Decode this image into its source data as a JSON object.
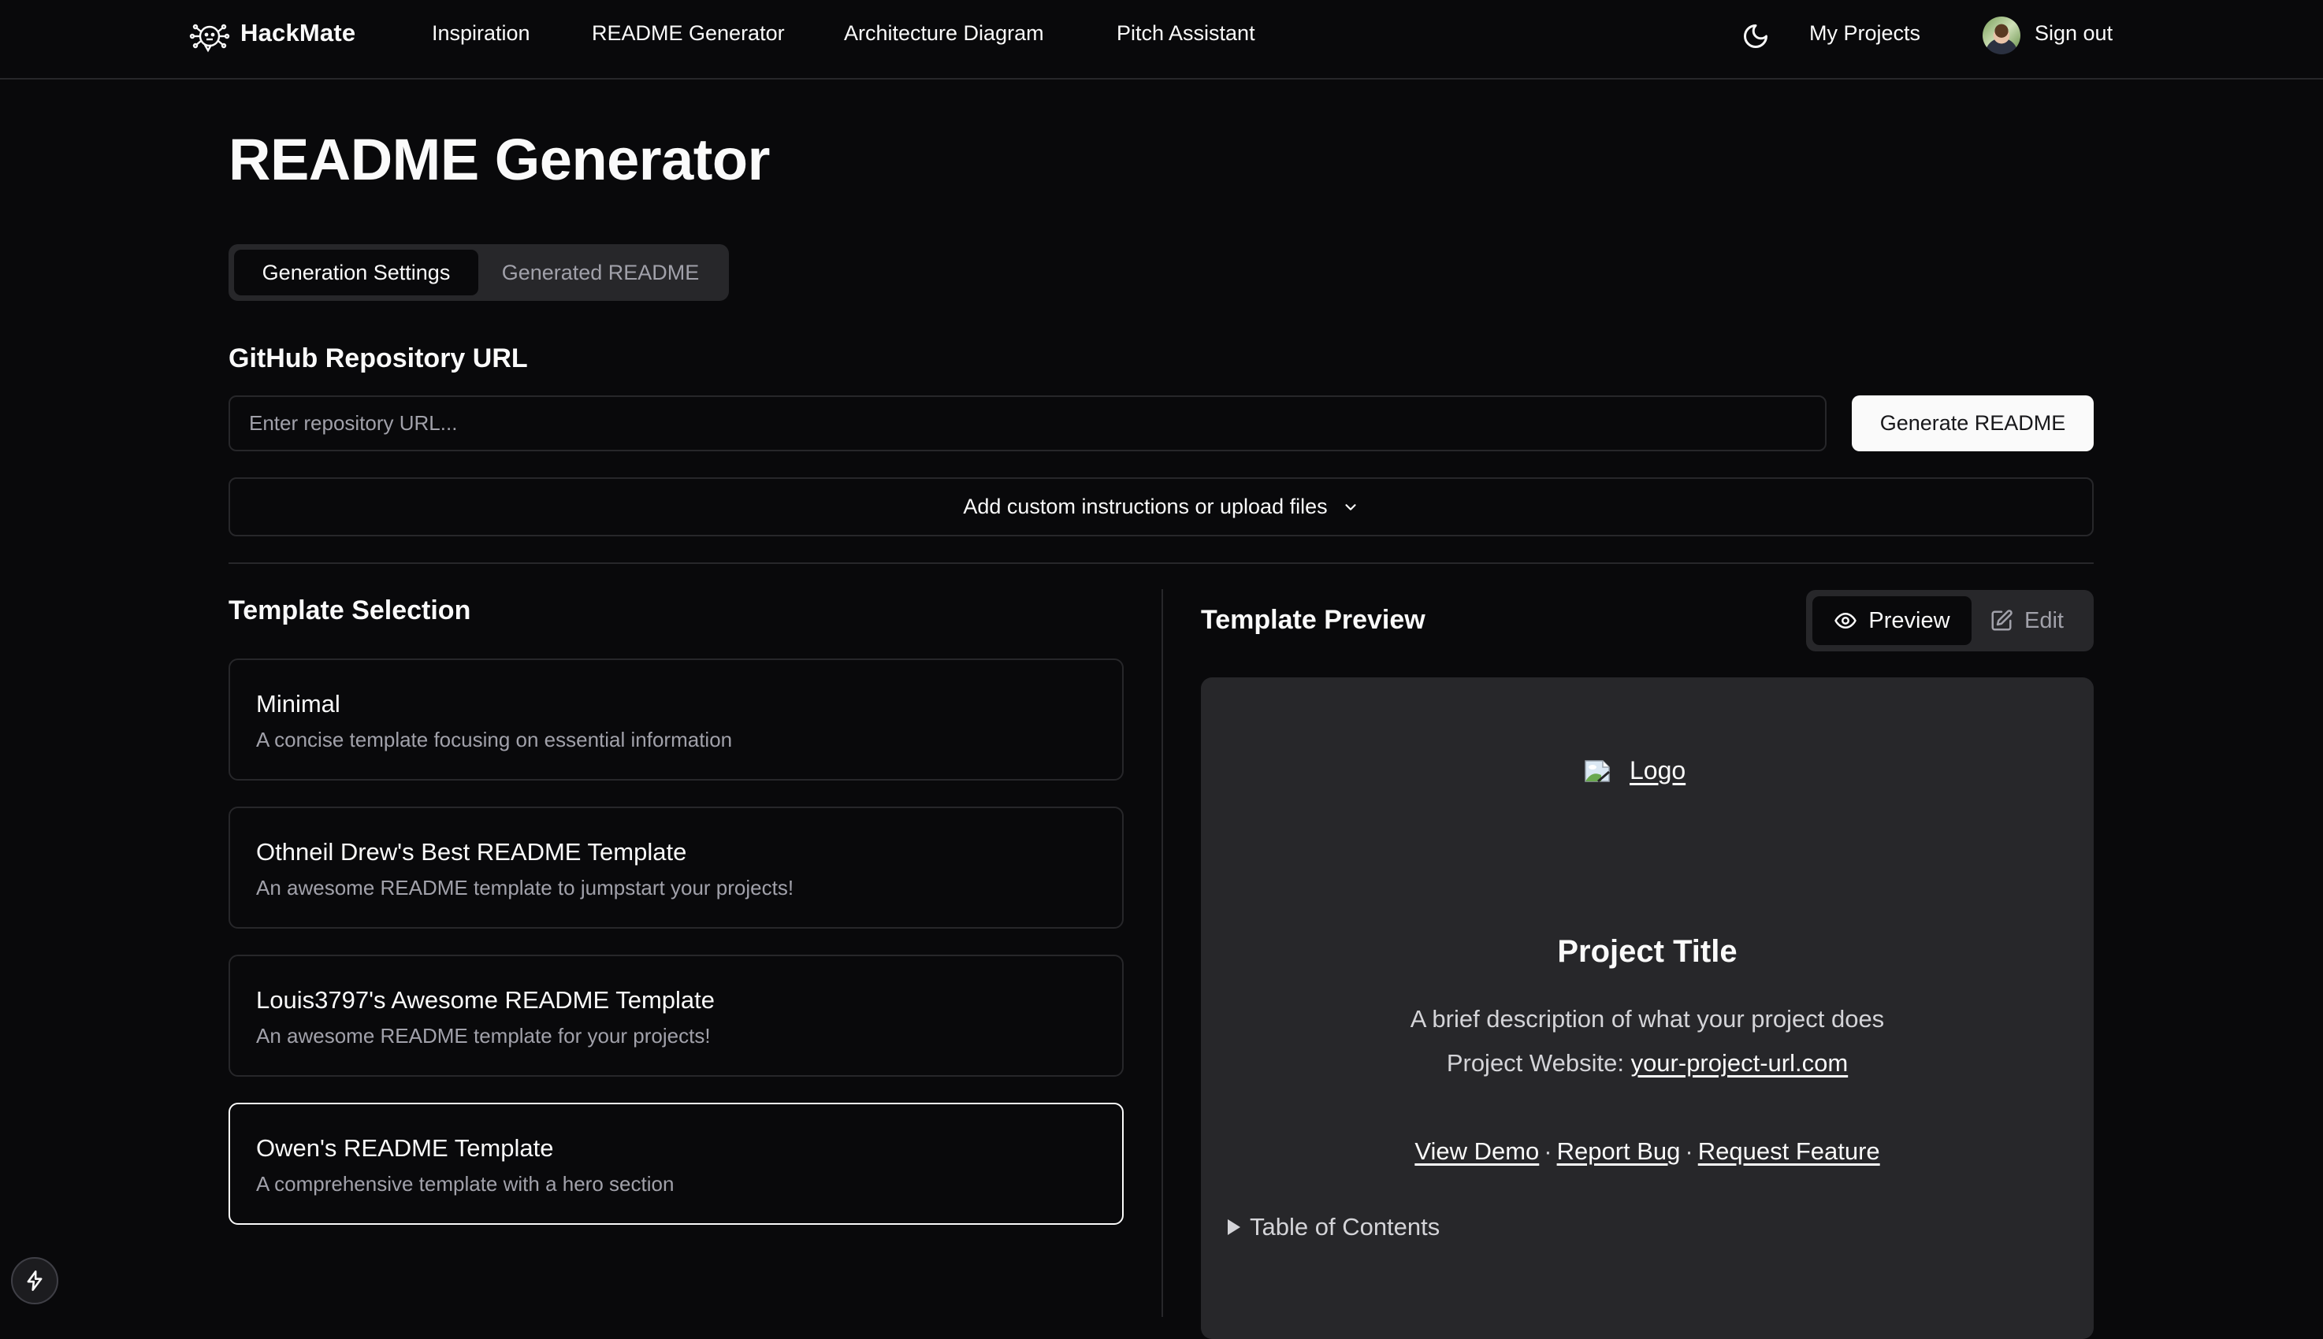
{
  "header": {
    "brand": "HackMate",
    "nav": [
      {
        "label": "Inspiration"
      },
      {
        "label": "README Generator"
      },
      {
        "label": "Architecture Diagram"
      },
      {
        "label": "Pitch Assistant"
      }
    ],
    "theme_icon": "moon-icon",
    "my_projects": "My Projects",
    "sign_out": "Sign out"
  },
  "page": {
    "title": "README Generator",
    "tabs": [
      {
        "label": "Generation Settings",
        "active": true
      },
      {
        "label": "Generated README",
        "active": false
      }
    ]
  },
  "repo": {
    "label": "GitHub Repository URL",
    "value": "",
    "placeholder": "Enter repository URL...",
    "generate_label": "Generate README"
  },
  "custom": {
    "label": "Add custom instructions or upload files",
    "icon": "chevron-down-icon"
  },
  "templates": {
    "title": "Template Selection",
    "items": [
      {
        "title": "Minimal",
        "description": "A concise template focusing on essential information",
        "selected": false
      },
      {
        "title": "Othneil Drew's Best README Template",
        "description": "An awesome README template to jumpstart your projects!",
        "selected": false
      },
      {
        "title": "Louis3797's Awesome README Template",
        "description": "An awesome README template for your projects!",
        "selected": false
      },
      {
        "title": "Owen's README Template",
        "description": "A comprehensive template with a hero section",
        "selected": true
      }
    ]
  },
  "preview": {
    "title": "Template Preview",
    "modes": [
      {
        "label": "Preview",
        "icon": "eye-icon",
        "active": true
      },
      {
        "label": "Edit",
        "icon": "edit-icon",
        "active": false
      }
    ],
    "content": {
      "logo_alt": "Logo",
      "project_title": "Project Title",
      "description": "A brief description of what your project does",
      "website_label": "Project Website: ",
      "website_link": "your-project-url.com",
      "links": [
        "View Demo",
        "Report Bug",
        "Request Feature"
      ],
      "separator": "·",
      "toc_label": "Table of Contents"
    }
  },
  "fab": {
    "icon": "lightning-icon"
  },
  "colors": {
    "background": "#09090b",
    "surface": "#27272a",
    "border": "#27272a",
    "text": "#fafafa",
    "muted": "#a1a1aa",
    "button_bg": "#fafafa"
  }
}
